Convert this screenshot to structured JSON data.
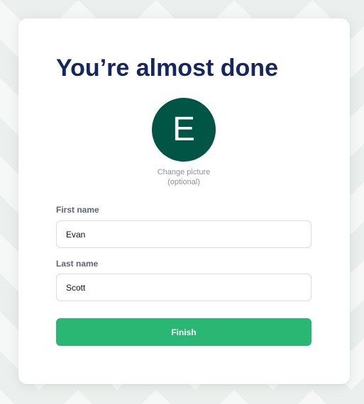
{
  "title": "You’re almost done",
  "avatar": {
    "initial": "E",
    "color": "#005544"
  },
  "change_picture": {
    "line1": "Change picture",
    "line2": "(optional)"
  },
  "form": {
    "first_name_label": "First name",
    "first_name_value": "Evan",
    "last_name_label": "Last name",
    "last_name_value": "Scott",
    "finish_label": "Finish"
  },
  "colors": {
    "title": "#17265c",
    "accent": "#2ab673",
    "label": "#5c6573"
  }
}
